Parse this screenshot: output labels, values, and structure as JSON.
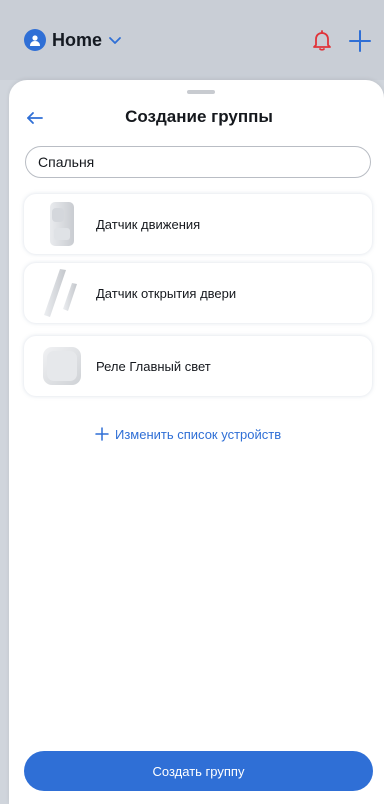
{
  "header": {
    "home_label": "Home"
  },
  "sheet": {
    "title": "Создание группы",
    "name_input_value": "Спальня",
    "devices": [
      {
        "name": "Датчик движения",
        "icon": "motion-sensor-icon"
      },
      {
        "name": "Датчик открытия двери",
        "icon": "door-sensor-icon"
      },
      {
        "name": "Реле Главный свет",
        "icon": "relay-icon"
      }
    ],
    "edit_devices_label": "Изменить список устройств",
    "create_button_label": "Создать группу"
  },
  "colors": {
    "accent": "#2f6fd6",
    "bell": "#e0343a",
    "text": "#15181d",
    "background_dim": "#c9ced6"
  }
}
